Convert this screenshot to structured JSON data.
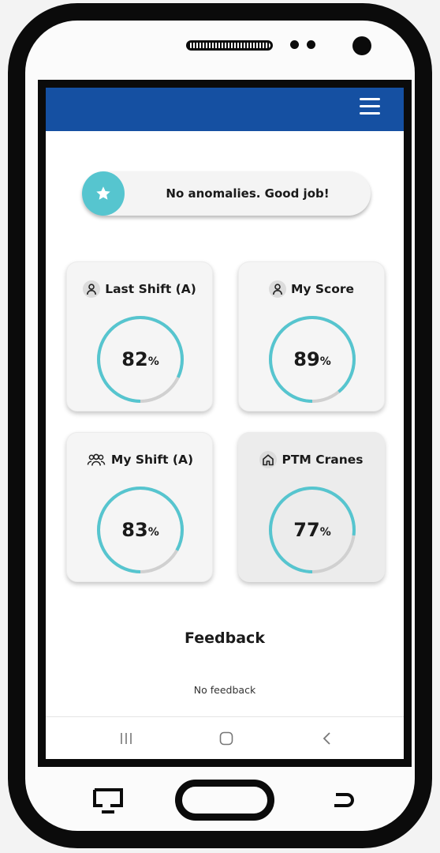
{
  "app": {
    "banner": {
      "text": "No anomalies. Good job!",
      "icon": "star-icon"
    },
    "cards": [
      {
        "title": "Last Shift (A)",
        "icon": "user-icon",
        "value": 82,
        "unit": "%",
        "progress": 0.82
      },
      {
        "title": "My Score",
        "icon": "user-icon",
        "value": 89,
        "unit": "%",
        "progress": 0.89
      },
      {
        "title": "My Shift (A)",
        "icon": "users-group-icon",
        "value": 83,
        "unit": "%",
        "progress": 0.83
      },
      {
        "title": "PTM Cranes",
        "icon": "crane-home-icon",
        "value": 77,
        "unit": "%",
        "progress": 0.77
      }
    ],
    "feedback": {
      "title": "Feedback",
      "text": "No feedback"
    },
    "navbar": {
      "icons": [
        "recent-apps-icon",
        "home-icon",
        "back-icon"
      ]
    }
  },
  "colors": {
    "header": "#1550a2",
    "accent": "#56c5cf",
    "ring_track": "#d0d0d0"
  }
}
